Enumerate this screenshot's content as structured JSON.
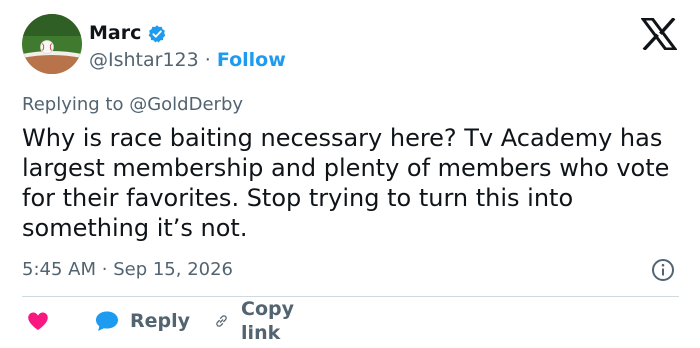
{
  "author": {
    "display_name": "Marc",
    "handle": "@Ishtar123",
    "separator": "·",
    "follow_label": "Follow",
    "avatar_icon": "baseball-on-field-avatar",
    "verified_icon": "verified-badge-icon"
  },
  "reply_context": {
    "prefix": "Replying to",
    "mention": "@GoldDerby"
  },
  "tweet": {
    "text": "Why is race baiting necessary here? Tv Academy has largest membership and plenty of members who vote for their favorites. Stop trying to turn this into something it’s not.",
    "time": "5:45 AM",
    "separator": "·",
    "date": "Sep 15, 2026"
  },
  "actions": {
    "like_icon": "heart-icon",
    "reply_label": "Reply",
    "reply_icon": "speech-bubble-icon",
    "copy_link_label": "Copy link",
    "copy_link_icon": "link-icon"
  },
  "icons": {
    "brand": "x-logo-icon",
    "info": "info-icon"
  },
  "colors": {
    "accent": "#1d9bf0",
    "like": "#f91880",
    "secondary_text": "#536471",
    "divider": "#cfd9de"
  }
}
